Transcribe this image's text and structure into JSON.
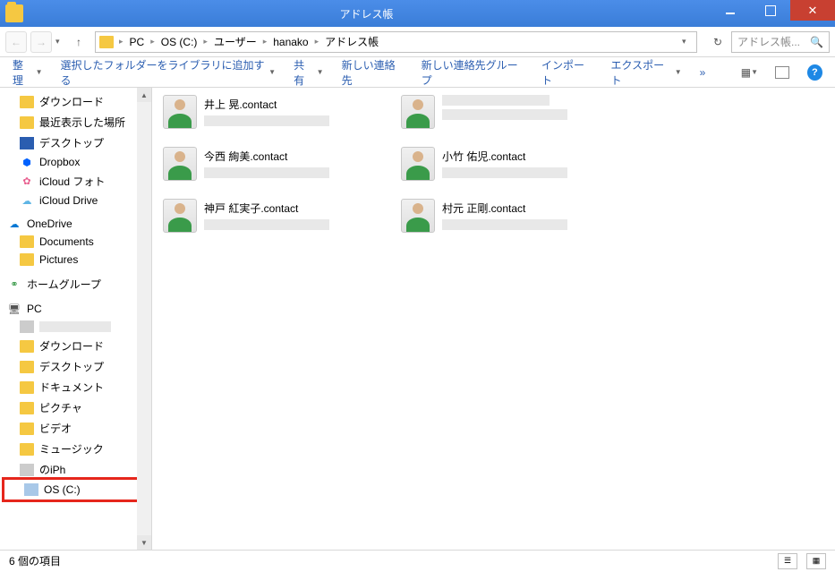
{
  "window": {
    "title": "アドレス帳"
  },
  "nav": {
    "up_arrow": "↑"
  },
  "breadcrumb": {
    "items": [
      "PC",
      "OS (C:)",
      "ユーザー",
      "hanako",
      "アドレス帳"
    ]
  },
  "search": {
    "placeholder": "アドレス帳..."
  },
  "toolbar": {
    "organize": "整理",
    "add_to_library": "選択したフォルダーをライブラリに追加する",
    "share": "共有",
    "new_contact": "新しい連絡先",
    "new_group": "新しい連絡先グループ",
    "import": "インポート",
    "export": "エクスポート",
    "overflow": "»"
  },
  "sidebar": {
    "items": [
      {
        "label": "ダウンロード",
        "icon": "folder"
      },
      {
        "label": "最近表示した場所",
        "icon": "recent"
      },
      {
        "label": "デスクトップ",
        "icon": "desktop"
      },
      {
        "label": "Dropbox",
        "icon": "dropbox"
      },
      {
        "label": "iCloud フォト",
        "icon": "icloud-photo"
      },
      {
        "label": "iCloud Drive",
        "icon": "icloud"
      }
    ],
    "onedrive": {
      "label": "OneDrive",
      "children": [
        "Documents",
        "Pictures"
      ]
    },
    "homegroup": "ホームグループ",
    "pc": {
      "label": "PC",
      "children": [
        {
          "label": "",
          "icon": "device"
        },
        {
          "label": "ダウンロード",
          "icon": "folder"
        },
        {
          "label": "デスクトップ",
          "icon": "folder"
        },
        {
          "label": "ドキュメント",
          "icon": "folder"
        },
        {
          "label": "ピクチャ",
          "icon": "folder"
        },
        {
          "label": "ビデオ",
          "icon": "folder"
        },
        {
          "label": "ミュージック",
          "icon": "folder"
        },
        {
          "label": "のiPh",
          "icon": "device"
        }
      ],
      "highlighted": {
        "label": "OS (C:)",
        "icon": "drive"
      }
    }
  },
  "contacts": [
    {
      "name": "井上 晃.contact"
    },
    {
      "name": ""
    },
    {
      "name": "今西 絢美.contact"
    },
    {
      "name": "小竹 佑児.contact"
    },
    {
      "name": "神戸 紅実子.contact"
    },
    {
      "name": "村元 正剛.contact"
    }
  ],
  "status": {
    "count_label": "6 個の項目"
  }
}
